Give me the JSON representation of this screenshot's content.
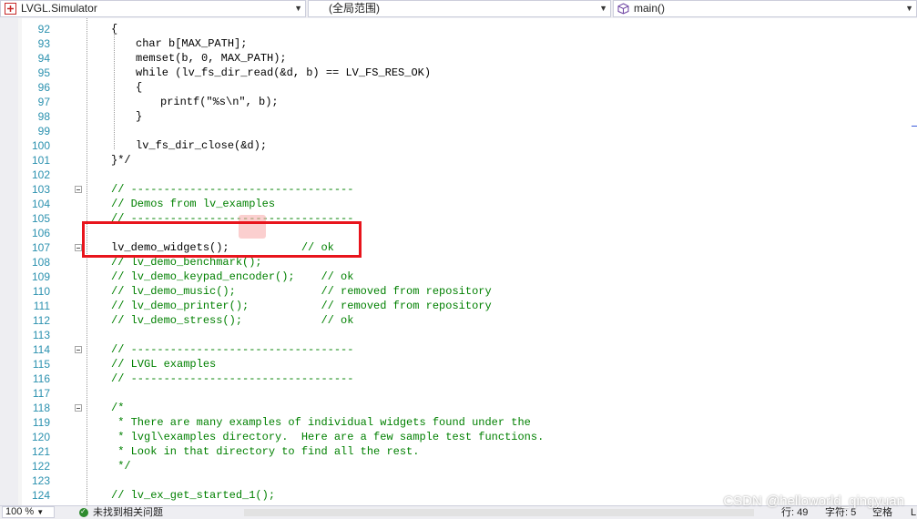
{
  "toolbar": {
    "project": "LVGL.Simulator",
    "scope": "(全局范围)",
    "member": "main()"
  },
  "lines": [
    {
      "n": "92",
      "text": "{",
      "k": true,
      "indent": 0
    },
    {
      "n": "93",
      "text": "char b[MAX_PATH];",
      "k": true,
      "indent": 1
    },
    {
      "n": "94",
      "text": "memset(b, 0, MAX_PATH);",
      "k": true,
      "indent": 1
    },
    {
      "n": "95",
      "text": "while (lv_fs_dir_read(&d, b) == LV_FS_RES_OK)",
      "k": true,
      "indent": 1
    },
    {
      "n": "96",
      "text": "{",
      "k": true,
      "indent": 1
    },
    {
      "n": "97",
      "text": "printf(\"%s\\n\", b);",
      "k": true,
      "indent": 2
    },
    {
      "n": "98",
      "text": "}",
      "k": true,
      "indent": 1
    },
    {
      "n": "99",
      "text": "",
      "k": true,
      "indent": 0
    },
    {
      "n": "100",
      "text": "lv_fs_dir_close(&d);",
      "k": true,
      "indent": 1
    },
    {
      "n": "101",
      "text": "}*/",
      "k": true,
      "indent": 0
    },
    {
      "n": "102",
      "text": "",
      "k": true,
      "indent": 0
    },
    {
      "n": "103",
      "text": "// ----------------------------------",
      "k": false,
      "indent": 0,
      "fold": true
    },
    {
      "n": "104",
      "text": "// Demos from lv_examples",
      "k": false,
      "indent": 0
    },
    {
      "n": "105",
      "text": "// ----------------------------------",
      "k": false,
      "indent": 0
    },
    {
      "n": "106",
      "text": "",
      "k": true,
      "indent": 0
    },
    {
      "n": "107",
      "text": "lv_demo_widgets();           // ok",
      "k": true,
      "indent": 0,
      "fold": true
    },
    {
      "n": "108",
      "text": "// lv_demo_benchmark();",
      "k": false,
      "indent": 0
    },
    {
      "n": "109",
      "text": "// lv_demo_keypad_encoder();    // ok",
      "k": false,
      "indent": 0
    },
    {
      "n": "110",
      "text": "// lv_demo_music();             // removed from repository",
      "k": false,
      "indent": 0
    },
    {
      "n": "111",
      "text": "// lv_demo_printer();           // removed from repository",
      "k": false,
      "indent": 0
    },
    {
      "n": "112",
      "text": "// lv_demo_stress();            // ok",
      "k": false,
      "indent": 0
    },
    {
      "n": "113",
      "text": "",
      "k": true,
      "indent": 0
    },
    {
      "n": "114",
      "text": "// ----------------------------------",
      "k": false,
      "indent": 0,
      "fold": true
    },
    {
      "n": "115",
      "text": "// LVGL examples",
      "k": false,
      "indent": 0
    },
    {
      "n": "116",
      "text": "// ----------------------------------",
      "k": false,
      "indent": 0
    },
    {
      "n": "117",
      "text": "",
      "k": true,
      "indent": 0
    },
    {
      "n": "118",
      "text": "/*",
      "k": false,
      "indent": 0,
      "fold": true
    },
    {
      "n": "119",
      "text": " * There are many examples of individual widgets found under the",
      "k": false,
      "indent": 0
    },
    {
      "n": "120",
      "text": " * lvgl\\examples directory.  Here are a few sample test functions.",
      "k": false,
      "indent": 0
    },
    {
      "n": "121",
      "text": " * Look in that directory to find all the rest.",
      "k": false,
      "indent": 0
    },
    {
      "n": "122",
      "text": " */",
      "k": false,
      "indent": 0
    },
    {
      "n": "123",
      "text": "",
      "k": true,
      "indent": 0
    },
    {
      "n": "124",
      "text": "// lv_ex_get_started_1();",
      "k": false,
      "indent": 0
    }
  ],
  "status": {
    "zoom": "100 %",
    "issues": "未找到相关问题",
    "row": "行: 49",
    "col": "字符: 5",
    "mode": "空格",
    "eol": "L"
  },
  "watermark": "CSDN @helloworld_qingyuan",
  "colors": {
    "comment": "#008000",
    "line_number": "#2b91af",
    "highlight_box": "#e8141c"
  }
}
